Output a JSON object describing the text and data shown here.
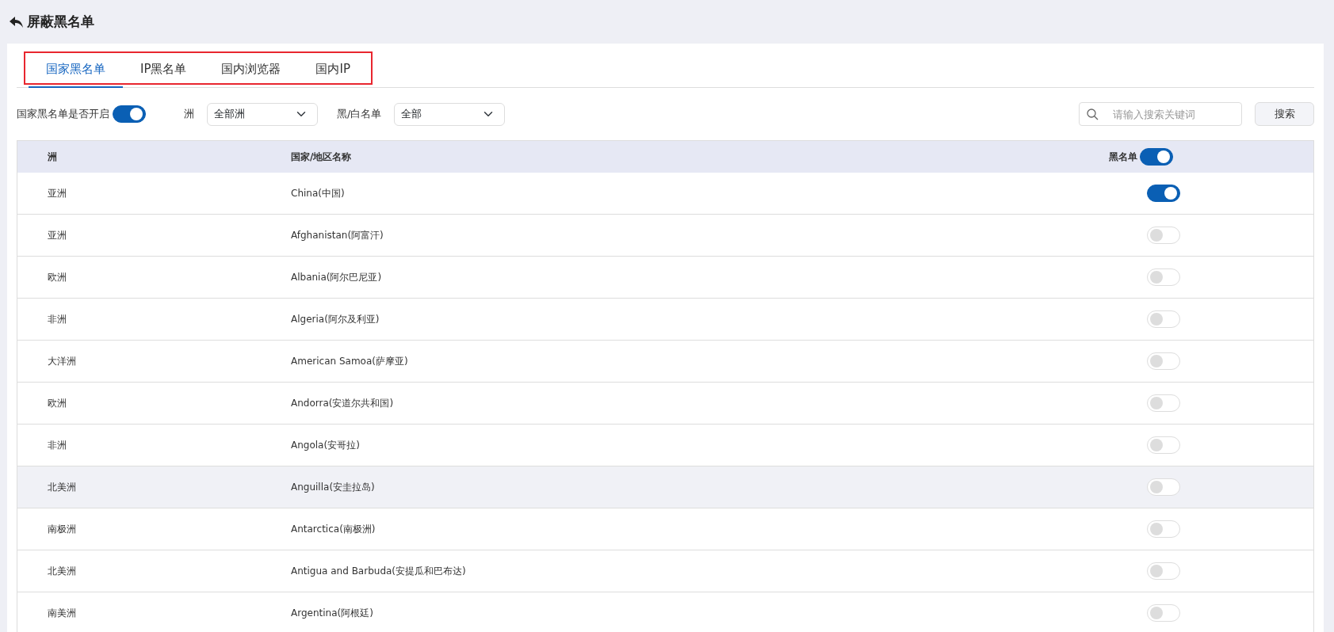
{
  "page_title": "屏蔽黑名单",
  "tabs": [
    {
      "label": "国家黑名单",
      "selected": true
    },
    {
      "label": "IP黑名单",
      "selected": false
    },
    {
      "label": "国内浏览器",
      "selected": false
    },
    {
      "label": "国内IP",
      "selected": false
    }
  ],
  "filters": {
    "enable_label": "国家黑名单是否开启",
    "enabled": true,
    "continent_label": "洲",
    "continent_value": "全部洲",
    "list_label": "黑/白名单",
    "list_value": "全部",
    "search_placeholder": "请输入搜索关键词",
    "search_button": "搜索"
  },
  "table": {
    "columns": [
      "洲",
      "国家/地区名称",
      "黑名单"
    ],
    "header_toggle_on": true,
    "rows": [
      {
        "continent": "亚洲",
        "country": "China(中国)",
        "blacklisted": true,
        "highlighted": false
      },
      {
        "continent": "亚洲",
        "country": "Afghanistan(阿富汗)",
        "blacklisted": false,
        "highlighted": false
      },
      {
        "continent": "欧洲",
        "country": "Albania(阿尔巴尼亚)",
        "blacklisted": false,
        "highlighted": false
      },
      {
        "continent": "非洲",
        "country": "Algeria(阿尔及利亚)",
        "blacklisted": false,
        "highlighted": false
      },
      {
        "continent": "大洋洲",
        "country": "American Samoa(萨摩亚)",
        "blacklisted": false,
        "highlighted": false
      },
      {
        "continent": "欧洲",
        "country": "Andorra(安道尔共和国)",
        "blacklisted": false,
        "highlighted": false
      },
      {
        "continent": "非洲",
        "country": "Angola(安哥拉)",
        "blacklisted": false,
        "highlighted": false
      },
      {
        "continent": "北美洲",
        "country": "Anguilla(安圭拉岛)",
        "blacklisted": false,
        "highlighted": true
      },
      {
        "continent": "南极洲",
        "country": "Antarctica(南极洲)",
        "blacklisted": false,
        "highlighted": false
      },
      {
        "continent": "北美洲",
        "country": "Antigua and Barbuda(安提瓜和巴布达)",
        "blacklisted": false,
        "highlighted": false
      },
      {
        "continent": "南美洲",
        "country": "Argentina(阿根廷)",
        "blacklisted": false,
        "highlighted": false
      }
    ]
  }
}
